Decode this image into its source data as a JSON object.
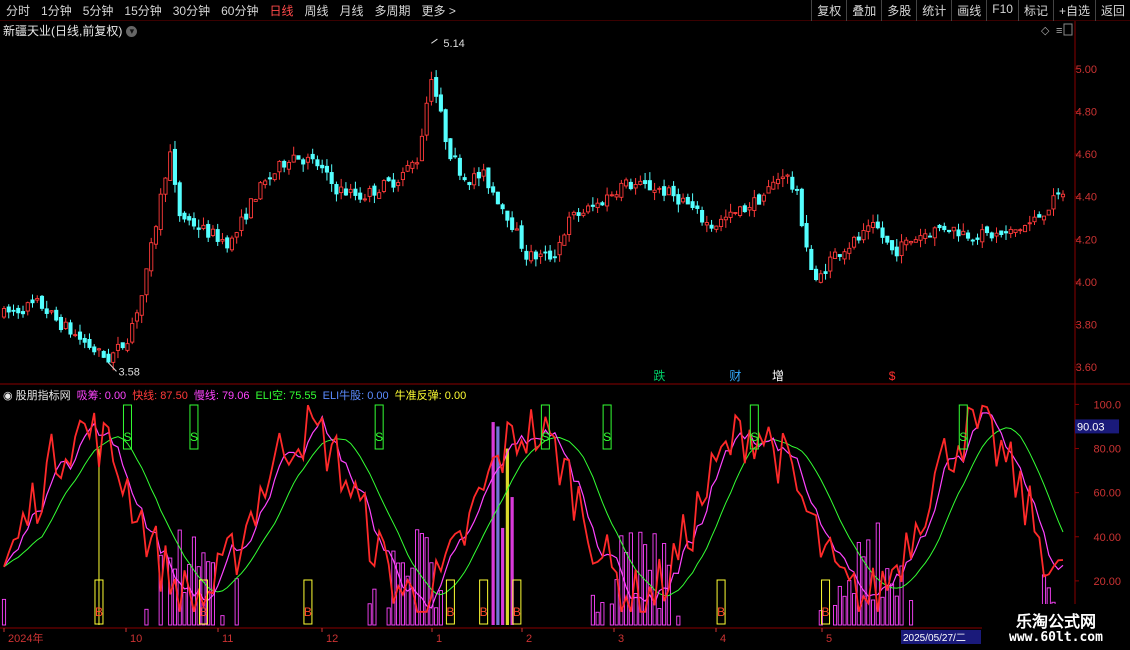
{
  "toolbar": {
    "periods": [
      "分时",
      "1分钟",
      "5分钟",
      "15分钟",
      "30分钟",
      "60分钟",
      "日线",
      "周线",
      "月线",
      "多周期",
      "更多 >"
    ],
    "active_period": "日线",
    "actions": [
      "复权",
      "叠加",
      "多股",
      "统计",
      "画线",
      "F10",
      "标记",
      "+自选",
      "返回"
    ]
  },
  "price_chart": {
    "title": "新疆天业(日线,前复权)",
    "y_ticks": [
      "5.00",
      "4.80",
      "4.60",
      "4.40",
      "4.20",
      "4.00",
      "3.80",
      "3.60"
    ],
    "y_range": [
      3.53,
      5.22
    ],
    "max_label": "5.14",
    "min_label": "3.58",
    "event_labels": [
      {
        "text": "跌",
        "color": "#00cc66",
        "day": 150
      },
      {
        "text": "财",
        "color": "#33aaff",
        "day": 168
      },
      {
        "text": "增",
        "color": "#ffffff",
        "day": 178
      },
      {
        "text": "$",
        "color": "#ff3030",
        "day": 204
      }
    ],
    "colors": {
      "up": "#ff3a3a",
      "down": "#54ffff"
    }
  },
  "indicator": {
    "title": "股朋指标网",
    "series_labels": [
      {
        "label": "吸筹: 0.00",
        "color": "#ff44ff"
      },
      {
        "label": "快线: 87.50",
        "color": "#ff3a3a"
      },
      {
        "label": "慢线: 79.06",
        "color": "#ff44ff"
      },
      {
        "label": "ELI空: 75.55",
        "color": "#33ff33"
      },
      {
        "label": "ELI牛股: 0.00",
        "color": "#5b8cff"
      },
      {
        "label": "牛准反弹: 0.00",
        "color": "#ffff33"
      }
    ],
    "y_ticks": [
      "100.0",
      "80.00",
      "60.00",
      "40.00",
      "20.00"
    ],
    "current_value": "90.03"
  },
  "x_axis": {
    "labels": [
      "2024年",
      "10",
      "11",
      "12",
      "1",
      "2",
      "3",
      "4",
      "5"
    ],
    "date_highlight": "2025/05/27/二"
  },
  "watermark": {
    "line1": "乐淘公式网",
    "line2": "www.60lt.com"
  }
}
